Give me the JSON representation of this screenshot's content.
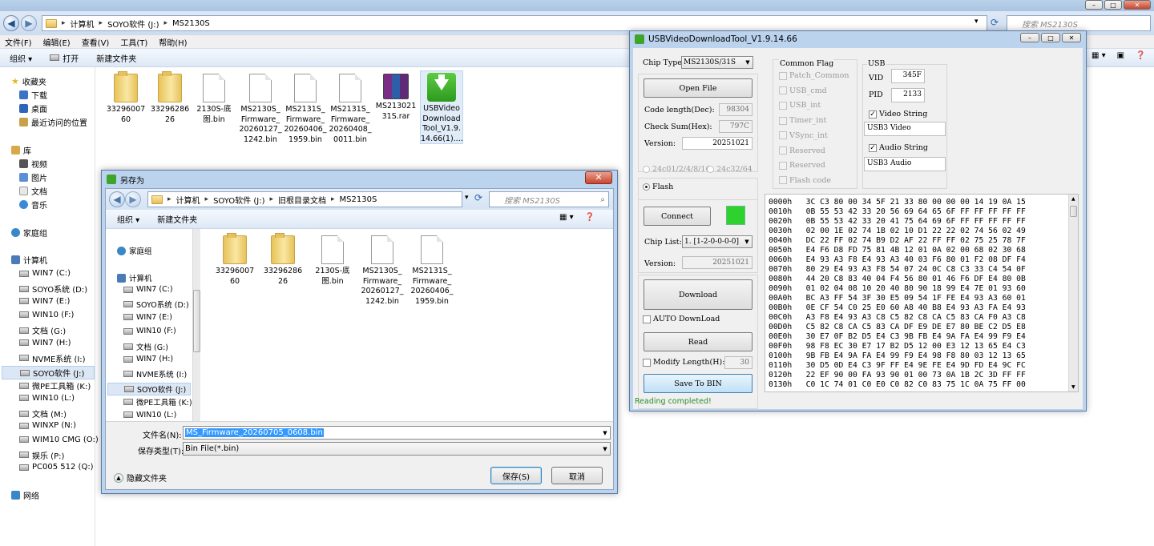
{
  "explorer": {
    "breadcrumb": [
      "计算机",
      "SOYO软件 (J:)",
      "MS2130S"
    ],
    "search_placeholder": "搜索 MS2130S",
    "menu": [
      "文件(F)",
      "编辑(E)",
      "查看(V)",
      "工具(T)",
      "帮助(H)"
    ],
    "commands": {
      "organize": "组织 ▾",
      "open": "打开",
      "new_folder": "新建文件夹"
    },
    "nav": {
      "favorites": "收藏夹",
      "fav_items": [
        "下载",
        "桌面",
        "最近访问的位置"
      ],
      "library": "库",
      "lib_items": [
        "视频",
        "图片",
        "文档",
        "音乐"
      ],
      "homegroup": "家庭组",
      "computer": "计算机",
      "drives": [
        "WIN7 (C:)",
        "SOYO系统 (D:)",
        "WIN7 (E:)",
        "WIN10 (F:)",
        "文档 (G:)",
        "WIN7 (H:)",
        "NVME系统 (I:)",
        "SOYO软件 (J:)",
        "微PE工具箱 (K:)",
        "WIN10 (L:)",
        "文档 (M:)",
        "WINXP (N:)",
        "WIM10 CMG (O:)",
        "娱乐 (P:)",
        "PC005 512 (Q:)"
      ],
      "network": "网络"
    },
    "files": [
      {
        "l1": "33296007",
        "l2": "60",
        "l3": "",
        "l4": ""
      },
      {
        "l1": "33296286",
        "l2": "26",
        "l3": "",
        "l4": ""
      },
      {
        "l1": "2130S-底",
        "l2": "图.bin",
        "l3": "",
        "l4": ""
      },
      {
        "l1": "MS2130S_",
        "l2": "Firmware_",
        "l3": "20260127_",
        "l4": "1242.bin"
      },
      {
        "l1": "MS2131S_",
        "l2": "Firmware_",
        "l3": "20260406_",
        "l4": "1959.bin"
      },
      {
        "l1": "MS2131S_",
        "l2": "Firmware_",
        "l3": "20260408_",
        "l4": "0011.bin"
      },
      {
        "l1": "MS213021",
        "l2": "31S.rar",
        "l3": "",
        "l4": ""
      },
      {
        "l1": "USBVideo",
        "l2": "Download",
        "l3": "Tool_V1.9.",
        "l4": "14.66(1)...."
      }
    ]
  },
  "save_dialog": {
    "title": "另存为",
    "close": "✕",
    "breadcrumb": [
      "计算机",
      "SOYO软件 (J:)",
      "旧根目录文档",
      "MS2130S"
    ],
    "search_placeholder": "搜索 MS2130S",
    "commands": {
      "organize": "组织 ▾",
      "new_folder": "新建文件夹"
    },
    "nav": {
      "homegroup": "家庭组",
      "computer": "计算机",
      "drives": [
        "WIN7 (C:)",
        "SOYO系统 (D:)",
        "WIN7 (E:)",
        "WIN10 (F:)",
        "文档 (G:)",
        "WIN7 (H:)",
        "NVME系统 (I:)",
        "SOYO软件 (J:)",
        "微PE工具箱 (K:)",
        "WIN10 (L:)"
      ]
    },
    "files": [
      {
        "l1": "33296007",
        "l2": "60",
        "l3": "",
        "l4": ""
      },
      {
        "l1": "33296286",
        "l2": "26",
        "l3": "",
        "l4": ""
      },
      {
        "l1": "2130S-底",
        "l2": "图.bin",
        "l3": "",
        "l4": ""
      },
      {
        "l1": "MS2130S_",
        "l2": "Firmware_",
        "l3": "20260127_",
        "l4": "1242.bin"
      },
      {
        "l1": "MS2131S_",
        "l2": "Firmware_",
        "l3": "20260406_",
        "l4": "1959.bin"
      }
    ],
    "filename_label": "文件名(N):",
    "filename_value": "MS_Firmware_20260705_0608.bin",
    "type_label": "保存类型(T):",
    "type_value": "Bin File(*.bin)",
    "hide_folders": "隐藏文件夹",
    "save": "保存(S)",
    "cancel": "取消"
  },
  "tool": {
    "title": "USBVideoDownloadTool_V1.9.14.66",
    "chip_type_label": "Chip Type:",
    "chip_type_value": "MS2130S/31S",
    "open_file": "Open File",
    "code_length_label": "Code length(Dec):",
    "code_length_value": "98304",
    "checksum_label": "Check Sum(Hex):",
    "checksum_value": "797C",
    "version_label": "Version:",
    "version_value": "20251021",
    "radio_24c01": "24c01/2/4/8/16",
    "radio_24c32": "24c32/64",
    "radio_flash": "Flash",
    "connect": "Connect",
    "connect_status_color": "#2fd12f",
    "chip_list_label": "Chip List:",
    "chip_list_value": "1. [1-2-0-0-0-0]",
    "version2_label": "Version:",
    "version2_value": "20251021",
    "download": "Download",
    "auto_download": "AUTO DownLoad",
    "read": "Read",
    "modify_length": "Modify  Length(H):",
    "modify_length_value": "30",
    "save_to_bin": "Save To BIN",
    "status": "Reading completed!",
    "common_flag_title": "Common Flag",
    "flags": [
      "Patch_Common",
      "USB_cmd",
      "USB_int",
      "Timer_int",
      "VSync_int",
      "Reserved",
      "Reserved",
      "Flash code"
    ],
    "usb_title": "USB",
    "vid_label": "VID",
    "vid_value": "345F",
    "pid_label": "PID",
    "pid_value": "2133",
    "video_string_label": "Video String",
    "video_string_value": "USB3 Video",
    "audio_string_label": "Audio String",
    "audio_string_value": "USB3 Audio",
    "hex_lines": [
      "0000h   3C C3 80 00 34 5F 21 33 80 00 00 00 14 19 0A 15",
      "0010h   0B 55 53 42 33 20 56 69 64 65 6F FF FF FF FF FF",
      "0020h   0B 55 53 42 33 20 41 75 64 69 6F FF FF FF FF FF",
      "0030h   02 00 1E 02 74 1B 02 10 D1 22 22 02 74 56 02 49",
      "0040h   DC 22 FF 02 74 B9 D2 AF 22 FF FF 02 75 25 78 7F",
      "0050h   E4 F6 D8 FD 75 81 4B 12 01 0A 02 00 68 02 30 68",
      "0060h   E4 93 A3 F8 E4 93 A3 40 03 F6 80 01 F2 08 DF F4",
      "0070h   80 29 E4 93 A3 F8 54 07 24 0C C8 C3 33 C4 54 0F",
      "0080h   44 20 C8 83 40 04 F4 56 80 01 46 F6 DF E4 80 0B",
      "0090h   01 02 04 08 10 20 40 80 90 18 99 E4 7E 01 93 60",
      "00A0h   BC A3 FF 54 3F 30 E5 09 54 1F FE E4 93 A3 60 01",
      "00B0h   0E CF 54 C0 25 E0 60 A8 40 B8 E4 93 A3 FA E4 93",
      "00C0h   A3 F8 E4 93 A3 C8 C5 82 C8 CA C5 83 CA F0 A3 C8",
      "00D0h   C5 82 C8 CA C5 83 CA DF E9 DE E7 80 BE C2 D5 E8",
      "00E0h   30 E7 0F B2 D5 E4 C3 9B FB E4 9A FA E4 99 F9 E4",
      "00F0h   98 F8 EC 30 E7 17 B2 D5 12 00 E3 12 13 65 E4 C3",
      "0100h   9B FB E4 9A FA E4 99 F9 E4 98 F8 80 03 12 13 65",
      "0110h   30 D5 0D E4 C3 9F FF E4 9E FE E4 9D FD E4 9C FC",
      "0120h   22 EF 90 00 FA 93 90 01 00 73 0A 1B 2C 3D FF FF",
      "0130h   C0 1C 74 01 C0 E0 C0 82 C0 83 75 1C 0A 75 FF 00"
    ]
  }
}
